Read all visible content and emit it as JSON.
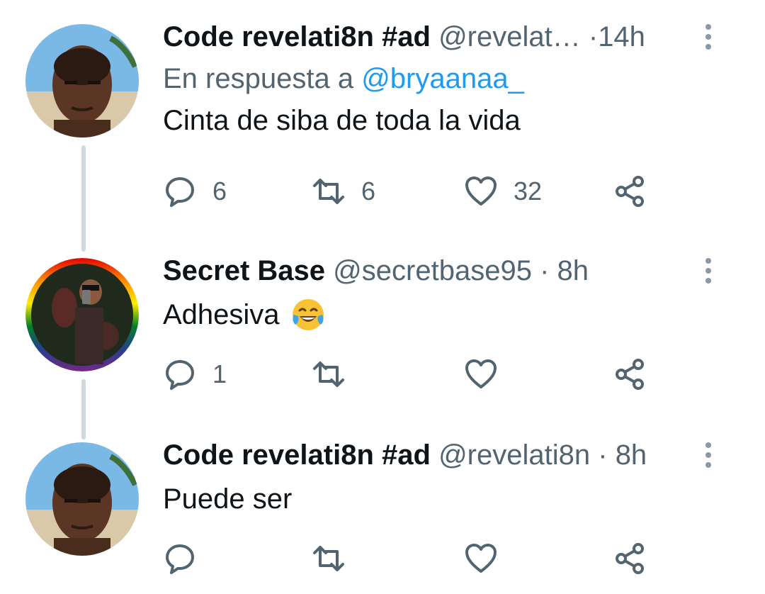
{
  "colors": {
    "accent": "#1d9bf0",
    "secondary_text": "#536471",
    "thread_line": "#cfd9de"
  },
  "tweets": [
    {
      "author_name": "Code revelati8n #ad",
      "handle": "@revelat…",
      "separator": "·",
      "time": "14h",
      "reply_prefix": "En respuesta a",
      "reply_mention": "@bryaanaa_",
      "text": "Cinta de siba de toda la vida",
      "replies": "6",
      "retweets": "6",
      "likes": "32"
    },
    {
      "author_name": "Secret Base",
      "handle": "@secretbase95",
      "separator": "·",
      "time": "8h",
      "text": "Adhesiva",
      "emoji": "face-with-tears-of-joy",
      "replies": "1",
      "retweets": "",
      "likes": ""
    },
    {
      "author_name": "Code revelati8n #ad",
      "handle": "@revelati8n",
      "separator": "·",
      "time": "8h",
      "text": "Puede ser",
      "replies": "",
      "retweets": "",
      "likes": ""
    }
  ]
}
